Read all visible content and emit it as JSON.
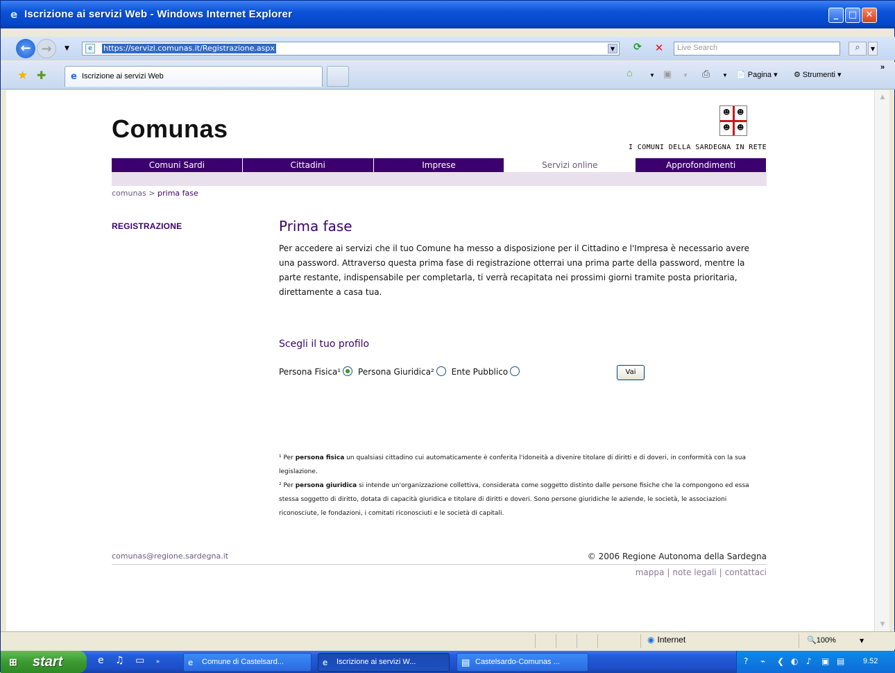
{
  "window": {
    "title": "Iscrizione ai servizi Web - Windows Internet Explorer"
  },
  "addressbar": {
    "url": "https://servizi.comunas.it/Registrazione.aspx",
    "search_placeholder": "Live Search"
  },
  "tabs": {
    "active_label": "Iscrizione ai servizi Web"
  },
  "commandbar": {
    "page_label": "Pagina",
    "tools_label": "Strumenti",
    "more_label": "»"
  },
  "page": {
    "logo": "Comunas",
    "tagline": "I COMUNI DELLA SARDEGNA IN RETE",
    "menu": [
      {
        "label": "Comuni Sardi"
      },
      {
        "label": "Cittadini"
      },
      {
        "label": "Imprese"
      },
      {
        "label": "Servizi online"
      },
      {
        "label": "Approfondimenti"
      }
    ],
    "breadcrumb": {
      "home": "comunas",
      "separator": " > ",
      "current": "prima fase"
    },
    "sidebar_heading": "REGISTRAZIONE",
    "heading": "Prima fase",
    "intro": "Per accedere ai servizi che il tuo Comune ha messo a disposizione per il Cittadino e l'Impresa è necessario avere una password. Attraverso questa prima fase di registrazione otterrai una prima parte della password, mentre la parte restante, indispensabile per completarla, ti verrà recapitata nei prossimi giorni tramite posta prioritaria, direttamente a casa tua.",
    "profile": {
      "heading": "Scegli il tuo profilo",
      "options": [
        {
          "label": "Persona Fisica¹",
          "selected": true
        },
        {
          "label": "Persona Giuridica²",
          "selected": false
        },
        {
          "label": "Ente Pubblico",
          "selected": false
        }
      ],
      "button": "Vai"
    },
    "notes": {
      "n1_prefix": "¹ Per ",
      "n1_bold": "persona fisica",
      "n1_text": " un qualsiasi cittadino cui automaticamente è conferita l'idoneità a divenire titolare di diritti e di doveri, in conformità con la sua legislazione.",
      "n2_prefix": "² Per ",
      "n2_bold": "persona giuridica",
      "n2_text": " si intende un'organizzazione collettiva, considerata come soggetto distinto dalle persone fisiche che la compongono ed essa stessa soggetto di diritto, dotata di capacità giuridica e titolare di diritti e doveri. Sono persone giuridiche le aziende, le società, le associazioni riconosciute, le fondazioni, i comitati riconosciuti e le società di capitali."
    },
    "footer": {
      "email": "comunas@regione.sardegna.it",
      "copyright": "© 2006 Regione Autonoma della Sardegna",
      "links": [
        "mappa",
        "note legali",
        "contattaci"
      ]
    }
  },
  "statusbar": {
    "zone": "Internet",
    "zoom": "100%"
  },
  "taskbar": {
    "start": "start",
    "items": [
      {
        "label": "Comune di Castelsard..."
      },
      {
        "label": "Iscrizione ai servizi W..."
      },
      {
        "label": "Castelsardo-Comunas ..."
      }
    ],
    "clock": "9.52"
  },
  "colors": {
    "brand_purple": "#3c006e",
    "accent_red": "#c81b1b",
    "xp_blue": "#0a52d8"
  }
}
